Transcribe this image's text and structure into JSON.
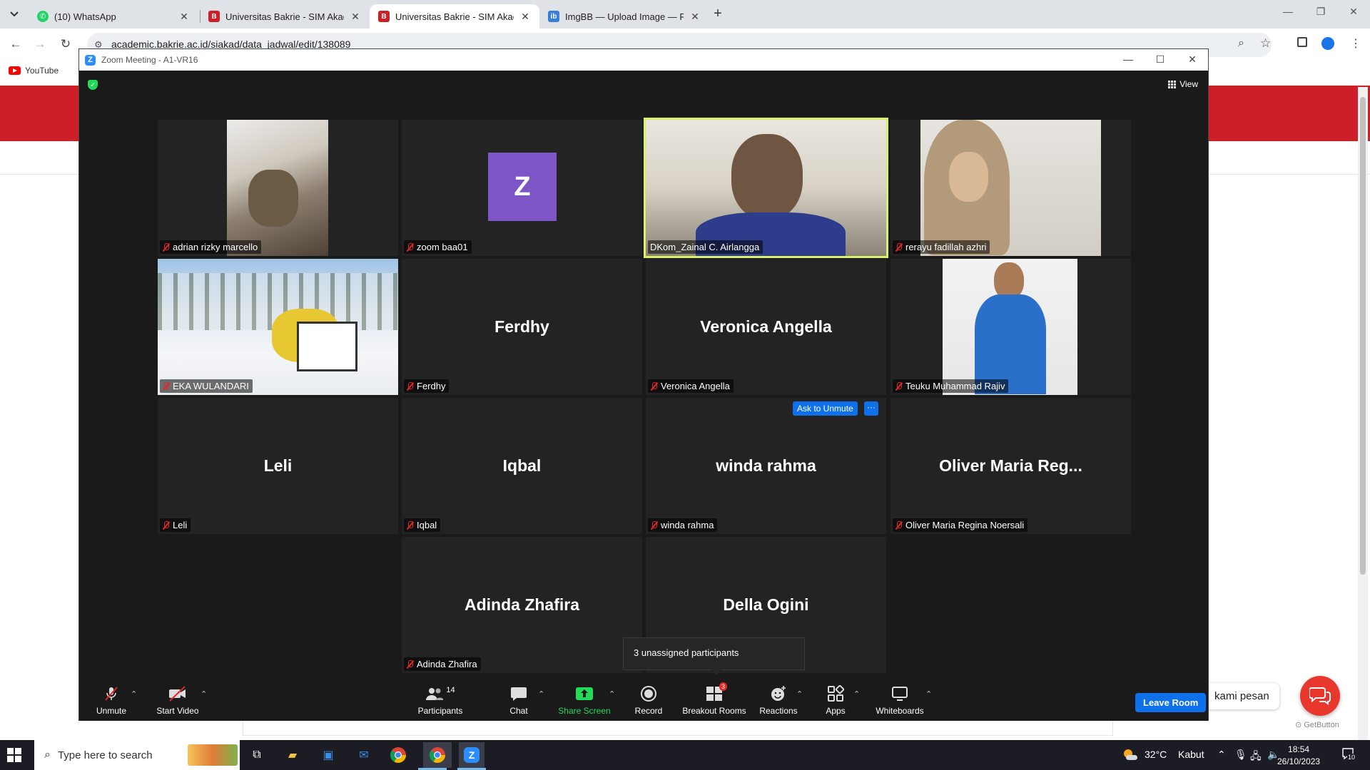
{
  "browser": {
    "tabs": [
      {
        "title": "(10) WhatsApp",
        "favicon": "whatsapp-icon",
        "active": false
      },
      {
        "title": "Universitas Bakrie - SIM Akade",
        "favicon": "ub-icon",
        "active": false
      },
      {
        "title": "Universitas Bakrie - SIM Akade",
        "favicon": "ub-icon",
        "active": true
      },
      {
        "title": "ImgBB — Upload Image — Fre",
        "favicon": "imgbb-icon",
        "active": false
      }
    ],
    "url": "academic.bakrie.ac.id/siakad/data_jadwal/edit/138089",
    "bookmarks": [
      {
        "label": "YouTube"
      }
    ]
  },
  "page": {
    "chat_bubble": "kami pesan",
    "getbutton": "GetButton"
  },
  "zoom": {
    "window_title": "Zoom Meeting - A1-VR16",
    "view_label": "View",
    "tiles": [
      {
        "display": "",
        "label": "adrian rizky marcello",
        "kind": "video"
      },
      {
        "display": "Z",
        "label": "zoom baa01",
        "kind": "avatar"
      },
      {
        "display": "",
        "label": "DKom_Zainal C. Airlangga",
        "kind": "video"
      },
      {
        "display": "",
        "label": "rerayu fadillah azhri",
        "kind": "video"
      },
      {
        "display": "",
        "label": "EKA WULANDARI",
        "kind": "video"
      },
      {
        "display": "Ferdhy",
        "label": "Ferdhy",
        "kind": "name"
      },
      {
        "display": "Veronica Angella",
        "label": "Veronica Angella",
        "kind": "name"
      },
      {
        "display": "",
        "label": "Teuku Muhammad Rajiv",
        "kind": "video"
      },
      {
        "display": "Leli",
        "label": "Leli",
        "kind": "name"
      },
      {
        "display": "Iqbal",
        "label": "Iqbal",
        "kind": "name"
      },
      {
        "display": "winda rahma",
        "label": "winda rahma",
        "kind": "name"
      },
      {
        "display": "Oliver Maria Reg...",
        "label": "Oliver Maria Regina Noersali",
        "kind": "name"
      },
      {
        "display": "Adinda Zhafira",
        "label": "Adinda Zhafira",
        "kind": "name"
      },
      {
        "display": "Della Ogini",
        "label": "Della Ogini",
        "kind": "name"
      }
    ],
    "ask_to_unmute": "Ask to Unmute",
    "more_label": "···",
    "tooltip": "3 unassigned participants",
    "toolbar": {
      "unmute": "Unmute",
      "start_video": "Start Video",
      "participants": "Participants",
      "participants_count": "14",
      "chat": "Chat",
      "share_screen": "Share Screen",
      "record": "Record",
      "breakout_rooms": "Breakout Rooms",
      "breakout_badge": "3",
      "reactions": "Reactions",
      "apps": "Apps",
      "whiteboards": "Whiteboards",
      "leave_room": "Leave Room"
    },
    "colors": {
      "active_speaker": "#d8f168",
      "primary": "#0e71eb",
      "share_green": "#23d959"
    }
  },
  "taskbar": {
    "search_placeholder": "Type here to search",
    "weather_temp": "32°C",
    "weather_desc": "Kabut",
    "time": "18:54",
    "date": "26/10/2023",
    "notification_count": "10"
  }
}
